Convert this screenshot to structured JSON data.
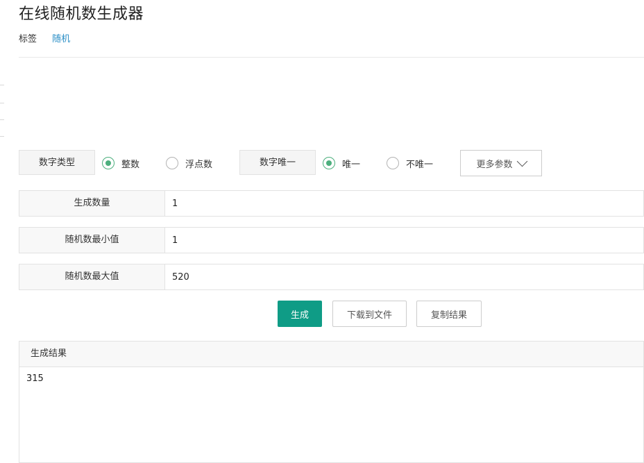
{
  "page": {
    "title": "在线随机数生成器",
    "tag_label": "标签",
    "tag_link": "随机"
  },
  "options": {
    "number_type_label": "数字类型",
    "integer_label": "整数",
    "float_label": "浮点数",
    "integer_selected": true,
    "unique_label": "数字唯一",
    "unique_option": "唯一",
    "non_unique_option": "不唯一",
    "unique_selected": true,
    "more_params_label": "更多参数"
  },
  "fields": {
    "count_label": "生成数量",
    "count_value": "1",
    "min_label": "随机数最小值",
    "min_value": "1",
    "max_label": "随机数最大值",
    "max_value": "520"
  },
  "actions": {
    "generate_label": "生成",
    "download_label": "下载到文件",
    "copy_label": "复制结果"
  },
  "result": {
    "header": "生成结果",
    "value": "315"
  },
  "colors": {
    "primary": "#0f9c86",
    "radio_checked": "#4caf7d",
    "link": "#2a8ec6"
  }
}
